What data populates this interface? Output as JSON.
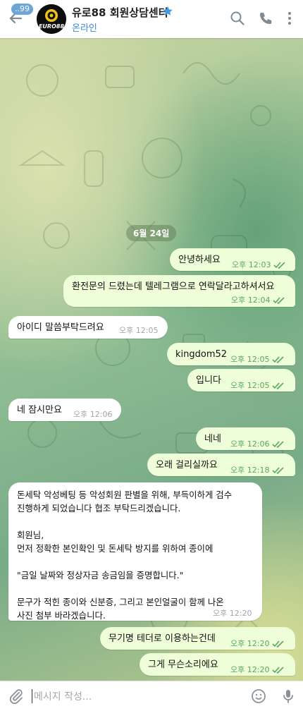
{
  "header": {
    "back_badge": "..99",
    "avatar_text": "EURO88",
    "title": "유로88 회원상담센터",
    "status": "온라인"
  },
  "date_separator": "6월 24일",
  "messages": [
    {
      "dir": "out",
      "text": "안녕하세요",
      "time": "오후 12:03",
      "read": true
    },
    {
      "dir": "out",
      "text": "환전문의 드렸는데 텔레그램으로 연락달라고하셔서요",
      "time": "오후 12:04",
      "read": true
    },
    {
      "dir": "in",
      "text": "아이디 말씀부탁드려요",
      "time": "오후 12:05"
    },
    {
      "dir": "out",
      "text": "kingdom52",
      "time": "오후 12:05",
      "read": true
    },
    {
      "dir": "out",
      "text": "입니다",
      "time": "오후 12:05",
      "read": true
    },
    {
      "dir": "in",
      "text": "네 잠시만요",
      "time": "오후 12:06"
    },
    {
      "dir": "out",
      "text": "네네",
      "time": "오후 12:06",
      "read": true
    },
    {
      "dir": "out",
      "text": "오래 걸리실까요",
      "time": "오후 12:18",
      "read": true
    },
    {
      "dir": "in",
      "text": "돈세탁 악성베팅 등 악성회원 판별을 위해, 부득이하게 검수\n진행하게 되었습니다 협조 부탁드리겠습니다.\n\n회원님,\n먼저 정확한 본인확인 및 돈세탁 방지를 위하여 종이에\n\n\"금일 날짜와 정상자금 송금임을 증명합니다.\"\n\n문구가 적힌 종이와 신분증, 그리고 본인얼굴이 함께 나온\n사진 첨부 바라겠습니다.",
      "time": "오후 12:20"
    },
    {
      "dir": "out",
      "text": "무기명 테더로 이용하는건데",
      "time": "오후 12:20",
      "read": true
    },
    {
      "dir": "out",
      "text": "그게 무슨소리에요",
      "time": "오후 12:20",
      "read": true
    }
  ],
  "composer": {
    "placeholder": "메시지 작성..."
  },
  "colors": {
    "outgoing_bubble": "#eefed9",
    "incoming_bubble": "#ffffff",
    "accent": "#3a8ad0",
    "read_ticks": "#59a760"
  },
  "icons": [
    "back-arrow-icon",
    "verified-star-icon",
    "search-icon",
    "phone-icon",
    "more-vert-icon",
    "attach-icon",
    "emoji-icon",
    "microphone-icon",
    "double-check-icon"
  ]
}
